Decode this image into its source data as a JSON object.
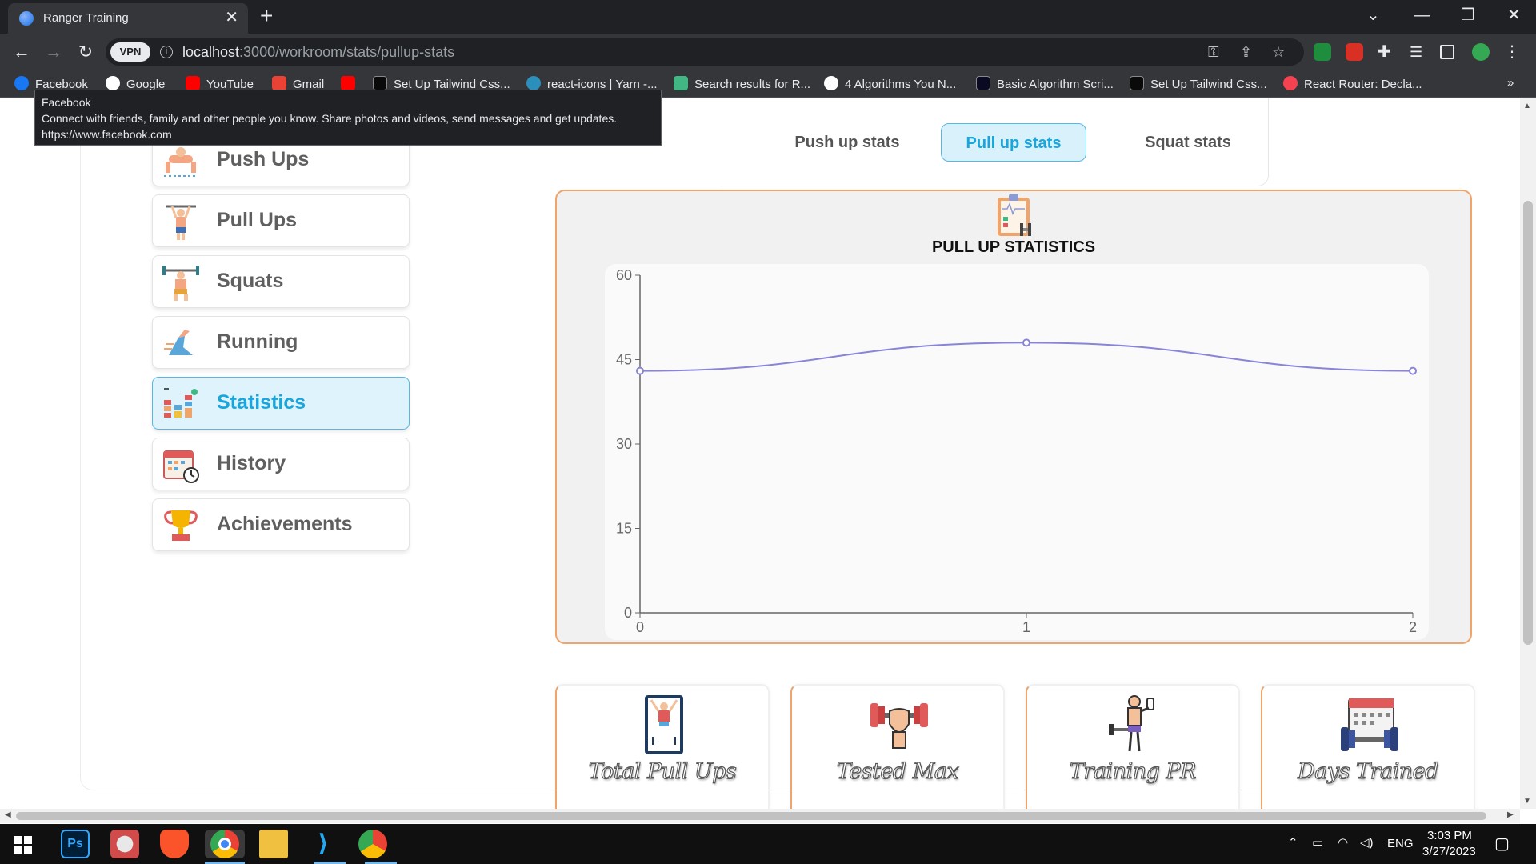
{
  "browser": {
    "tab_title": "Ranger Training",
    "url_host": "localhost",
    "url_path": ":3000/workroom/stats/pullup-stats",
    "vpn_label": "VPN",
    "bookmarks": [
      {
        "label": "Facebook",
        "icon": "facebook-icon",
        "color": "#1877f2"
      },
      {
        "label": "Google",
        "icon": "google-icon",
        "color": "#ffffff"
      },
      {
        "label": "YouTube",
        "icon": "youtube-icon",
        "color": "#ff0000"
      },
      {
        "label": "Gmail",
        "icon": "gmail-icon",
        "color": "#ea4335"
      },
      {
        "label": "",
        "icon": "youtube-icon",
        "color": "#ff0000"
      },
      {
        "label": "Set Up Tailwind Css...",
        "icon": "dev-icon",
        "color": "#0a0a0a"
      },
      {
        "label": "react-icons | Yarn -...",
        "icon": "yarn-icon",
        "color": "#2c8ebb"
      },
      {
        "label": "Search results for R...",
        "icon": "vue-icon",
        "color": "#41b883"
      },
      {
        "label": "4 Algorithms You N...",
        "icon": "medium-icon",
        "color": "#ffffff"
      },
      {
        "label": "Basic Algorithm Scri...",
        "icon": "freecodecamp-icon",
        "color": "#0a0a23"
      },
      {
        "label": "Set Up Tailwind Css...",
        "icon": "dev-icon",
        "color": "#0a0a0a"
      },
      {
        "label": "React Router: Decla...",
        "icon": "react-router-icon",
        "color": "#f44250"
      }
    ]
  },
  "tooltip": {
    "title": "Facebook",
    "description": "Connect with friends, family and other people you know. Share photos and videos, send messages and get updates.",
    "url": "https://www.facebook.com"
  },
  "sidebar": {
    "items": [
      {
        "label": "Push Ups",
        "icon": "push-ups-icon",
        "active": false
      },
      {
        "label": "Pull Ups",
        "icon": "pull-ups-icon",
        "active": false
      },
      {
        "label": "Squats",
        "icon": "squats-icon",
        "active": false
      },
      {
        "label": "Running",
        "icon": "running-icon",
        "active": false
      },
      {
        "label": "Statistics",
        "icon": "statistics-icon",
        "active": true
      },
      {
        "label": "History",
        "icon": "history-icon",
        "active": false
      },
      {
        "label": "Achievements",
        "icon": "trophy-icon",
        "active": false
      }
    ]
  },
  "stat_tabs": [
    {
      "label": "Push up stats",
      "active": false
    },
    {
      "label": "Pull up stats",
      "active": true
    },
    {
      "label": "Squat stats",
      "active": false
    }
  ],
  "chart_card": {
    "title": "PULL UP STATISTICS",
    "icon": "clipboard-stats-icon"
  },
  "chart_data": {
    "type": "line",
    "title": "PULL UP STATISTICS",
    "x": [
      0,
      1,
      2
    ],
    "series": [
      {
        "values": [
          43,
          48,
          43
        ],
        "color": "#8884d8"
      }
    ],
    "xlim": [
      0,
      2
    ],
    "ylim": [
      0,
      60
    ],
    "yticks": [
      0,
      15,
      30,
      45,
      60
    ],
    "xticks": [
      0,
      1,
      2
    ],
    "xlabel": "",
    "ylabel": "",
    "grid": false
  },
  "metrics": [
    {
      "label": "Total Pull Ups",
      "icon": "pull-up-bar-icon",
      "value": ""
    },
    {
      "label": "Tested Max",
      "icon": "dumbbell-hand-icon",
      "value": ""
    },
    {
      "label": "Training PR",
      "icon": "lifter-icon",
      "value": ""
    },
    {
      "label": "Days Trained",
      "icon": "calendar-dumbbell-icon",
      "value": ""
    }
  ],
  "taskbar": {
    "language": "ENG",
    "time": "3:03 PM",
    "date": "3/27/2023",
    "apps": [
      "windows-start-icon",
      "photoshop-icon",
      "snipping-tool-icon",
      "brave-icon",
      "chrome-icon",
      "file-explorer-icon",
      "vscode-icon",
      "chrome-profile-icon"
    ]
  },
  "colors": {
    "accent": "#19a6dd",
    "active_bg": "#def3fb",
    "card_border": "#f0a46a",
    "line": "#8884d8"
  }
}
